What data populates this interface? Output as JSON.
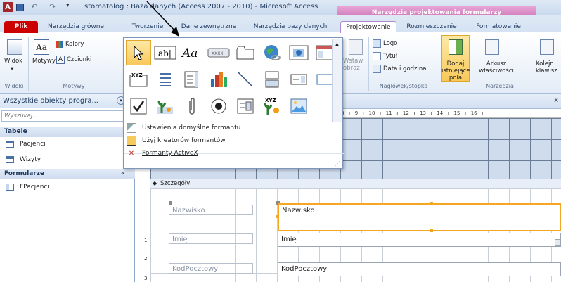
{
  "title": {
    "text": "stomatolog : Baza danych (Access 2007 - 2010)  -  Microsoft Access",
    "context_header": "Narzędzia projektowania formularzy",
    "app_icon_letter": "A"
  },
  "tabs": {
    "file": "Plik",
    "home": "Narzędzia główne",
    "create": "Tworzenie",
    "external": "Dane zewnętrzne",
    "dbtools": "Narzędzia bazy danych",
    "design": "Projektowanie",
    "arrange": "Rozmieszczanie",
    "format": "Formatowanie"
  },
  "ribbon": {
    "views_label": "Widok",
    "views_group": "Widoki",
    "themes_label": "Motywy",
    "colors_label": "Kolory",
    "fonts_label": "Czcionki",
    "themes_group": "Motywy",
    "insert_image": "Wstaw obraz",
    "logo": "Logo",
    "title_label": "Tytuł",
    "date_time": "Data i godzina",
    "header_group": "Nagłówek/stopka",
    "add_fields": "Dodaj istniejące pola",
    "property_sheet": "Arkusz właściwości",
    "tab_order": "Kolejn klawisz",
    "tools_group": "Narzędzia"
  },
  "gallery": {
    "items": [
      "select-pointer",
      "text-box",
      "label",
      "button",
      "tab-control",
      "hyperlink",
      "web-browser",
      "navigation-control",
      "option-group",
      "page-break",
      "combo-box",
      "chart",
      "line",
      "toggle-button",
      "list-box",
      "rectangle",
      "check-box",
      "unbound-object-frame",
      "attachment",
      "option-button",
      "subform",
      "bound-object-frame",
      "image"
    ],
    "menu": {
      "defaults": "Ustawienia domyślne formantu",
      "wizards": "Użyj kreatorów formantów",
      "activex": "Formanty ActiveX"
    }
  },
  "nav": {
    "header": "Wszystkie obiekty progra...",
    "search_placeholder": "Wyszukaj...",
    "group_tables": "Tabele",
    "table_1": "Pacjenci",
    "table_2": "Wizyty",
    "group_forms": "Formularze",
    "form_1": "FPacjenci"
  },
  "design": {
    "section_detail": "Szczegóły",
    "label_1": "Nazwisko",
    "field_1": "Nazwisko",
    "label_2": "Imię",
    "field_2": "Imię",
    "label_3": "KodPocztowy",
    "field_3": "KodPocztowy",
    "ruler_numbers": "8 · ı · 9 · ı · 10 · ı · 11 · ı · 12 · ı · 13 · ı · 14 · ı · 15 · ı · 16 · ı",
    "ruler_left": [
      "1",
      "2",
      "3"
    ]
  },
  "colors": {
    "file_tab": "#cc0000",
    "context_tab": "#c76bb0",
    "selection": "#f5a623",
    "grid": "#cfdced"
  }
}
